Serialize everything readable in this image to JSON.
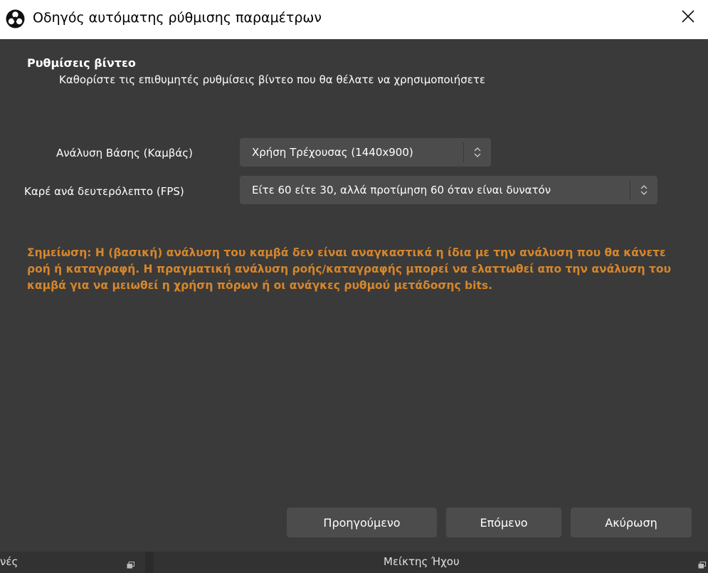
{
  "window": {
    "title": "Οδηγός αυτόματης ρύθμισης παραμέτρων",
    "icons": {
      "app": "obs-logo-icon",
      "close": "close-icon"
    }
  },
  "section": {
    "title": "Ρυθμίσεις βίντεο",
    "subtitle": "Καθορίστε τις επιθυμητές ρυθμίσεις βίντεο που θα θέλατε να χρησιμοποιήσετε"
  },
  "fields": {
    "base_resolution": {
      "label": "Ανάλυση Βάσης (Καμβάς)",
      "value": "Χρήση Τρέχουσας (1440x900)"
    },
    "fps": {
      "label": "Καρέ ανά δευτερόλεπτο (FPS)",
      "value": "Είτε 60 είτε 30, αλλά προτίμηση 60 όταν είναι δυνατόν"
    }
  },
  "note": "Σημείωση: Η (βασική) ανάλυση του καμβά δεν είναι αναγκαστικά η ίδια με την ανάλυση που θα κάνετε ροή ή καταγραφή. Η πραγματική ανάλυση ροής/καταγραφής μπορεί να ελαττωθεί απο την ανάλυση του καμβά για να μειωθεί η χρήση πόρων ή οι ανάγκες ρυθμού μετάδοσης bits.",
  "buttons": {
    "previous": "Προηγούμενο",
    "next": "Επόμενο",
    "cancel": "Ακύρωση"
  },
  "dock": {
    "left_label": "νές",
    "right_label": "Μείκτης Ήχου",
    "icons": {
      "float": "float-dock-icon"
    }
  },
  "colors": {
    "titlebar": "#ffffff",
    "background": "#3a3a3a",
    "control": "#4c4c4c",
    "note": "#d6862b"
  }
}
